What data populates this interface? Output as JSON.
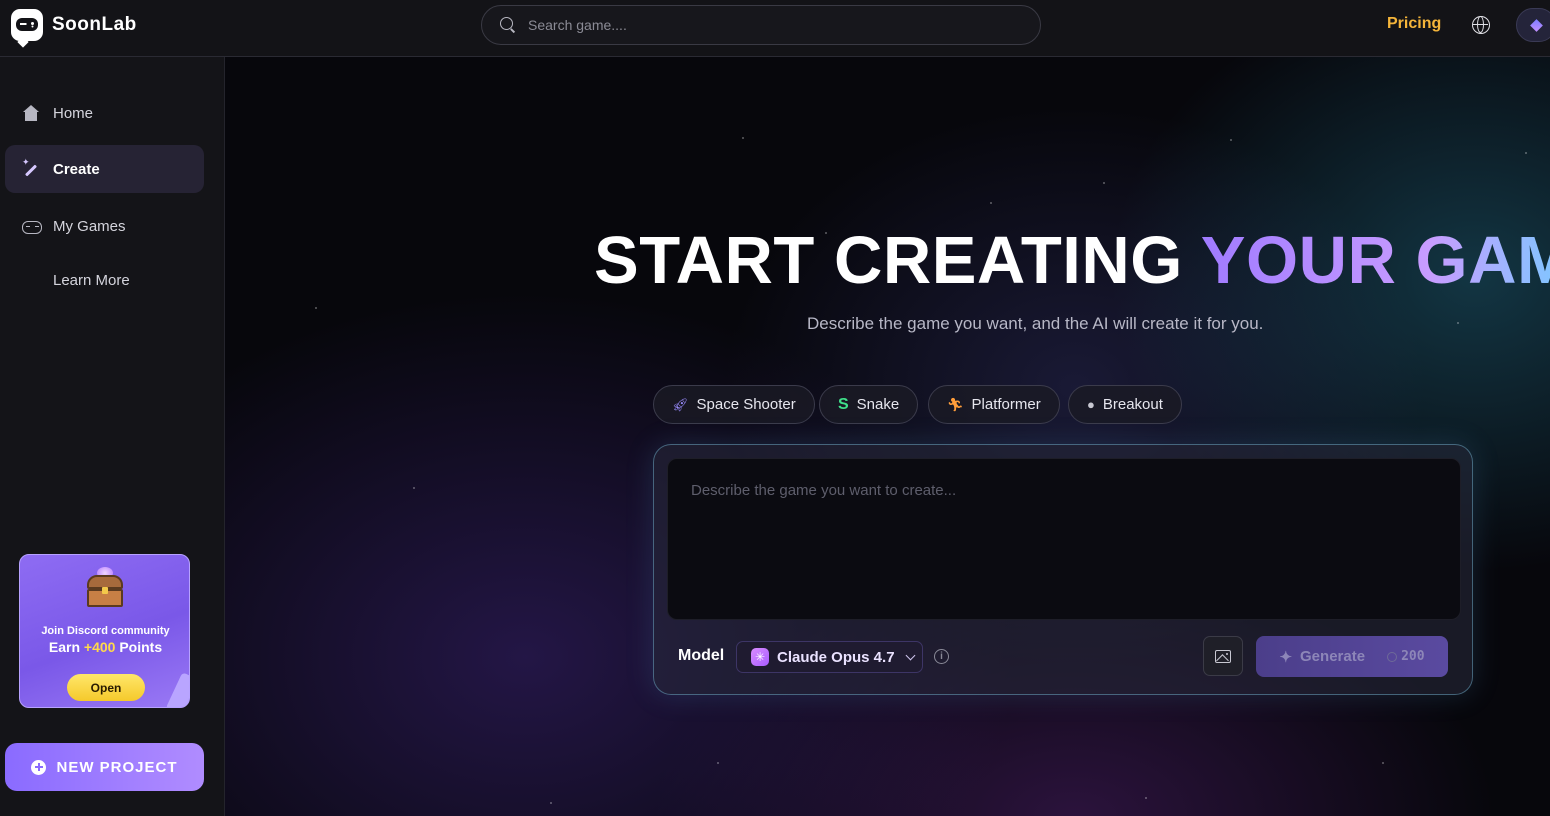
{
  "app": {
    "name": "SoonLab"
  },
  "header": {
    "search_placeholder": "Search game....",
    "pricing_label": "Pricing"
  },
  "sidebar": {
    "items": [
      {
        "label": "Home",
        "icon": "home-icon",
        "active": false
      },
      {
        "label": "Create",
        "icon": "wand-icon",
        "active": true
      },
      {
        "label": "My Games",
        "icon": "gamepad-icon",
        "active": false
      },
      {
        "label": "Learn More",
        "icon": "grid-icon",
        "active": false
      }
    ],
    "promo": {
      "line1": "Join Discord community",
      "line2_prefix": "Earn ",
      "points": "+400",
      "line2_suffix": " Points",
      "button_label": "Open"
    },
    "new_project_label": "NEW PROJECT"
  },
  "hero": {
    "title_plain": "START CREATING ",
    "title_highlight": "YOUR GAME",
    "subtitle": "Describe the game you want, and the AI will create it for you."
  },
  "chips": [
    {
      "label": "Space Shooter",
      "icon": "rocket-icon"
    },
    {
      "label": "Snake",
      "icon": "snake-icon"
    },
    {
      "label": "Platformer",
      "icon": "runner-icon"
    },
    {
      "label": "Breakout",
      "icon": "ball-icon"
    }
  ],
  "prompt": {
    "placeholder": "Describe the game you want to create...",
    "model_label": "Model",
    "model_value": "Claude Opus 4.7",
    "generate_label": "Generate",
    "cost": "200"
  },
  "colors": {
    "accent": "#8a6bff",
    "pricing": "#f5b53a",
    "points": "#ffd94a"
  }
}
